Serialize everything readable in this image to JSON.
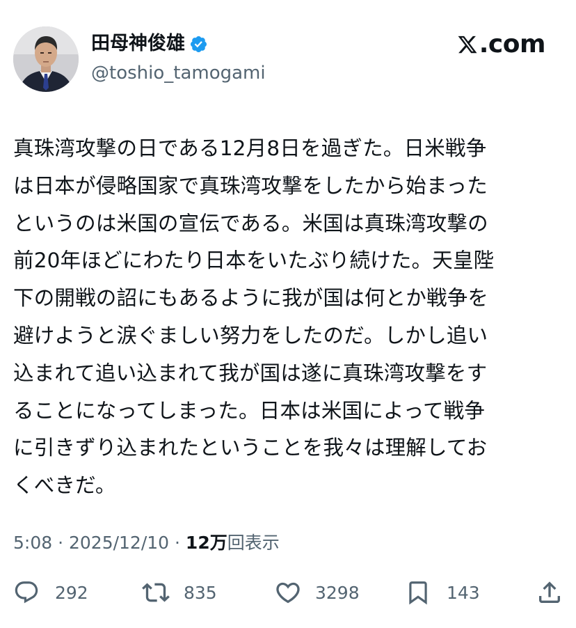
{
  "author": {
    "display_name": "田母神俊雄",
    "handle": "@toshio_tamogami",
    "verified": true,
    "verified_color": "#1d9bf0"
  },
  "site_logo": {
    "icon": "x-logo-icon",
    "text": ".com"
  },
  "tweet": {
    "lines": [
      "真珠湾攻撃の日である12月8日を過ぎた。日米戦争",
      "は日本が侵略国家で真珠湾攻撃をしたから始まった",
      "というのは米国の宣伝である。米国は真珠湾攻撃の",
      "前20年ほどにわたり日本をいたぶり続けた。天皇陛",
      "下の開戦の詔にもあるように我が国は何とか戦争を",
      "避けようと涙ぐましい努力をしたのだ。しかし追い",
      "込まれて追い込まれて我が国は遂に真珠湾攻撃をす",
      "ることになってしまった。日本は米国によって戦争",
      "に引きずり込まれたということを我々は理解してお",
      "くべきだ。"
    ]
  },
  "meta": {
    "time": "5:08",
    "separator": " · ",
    "date": "2025/12/10",
    "views_count": "12万",
    "views_label": "回表示"
  },
  "actions": {
    "replies": {
      "icon": "reply-icon",
      "count": "292"
    },
    "reposts": {
      "icon": "repost-icon",
      "count": "835"
    },
    "likes": {
      "icon": "heart-icon",
      "count": "3298"
    },
    "bookmarks": {
      "icon": "bookmark-icon",
      "count": "143"
    },
    "share": {
      "icon": "share-icon"
    }
  },
  "colors": {
    "text": "#0f1419",
    "secondary": "#536471",
    "background": "#ffffff"
  }
}
